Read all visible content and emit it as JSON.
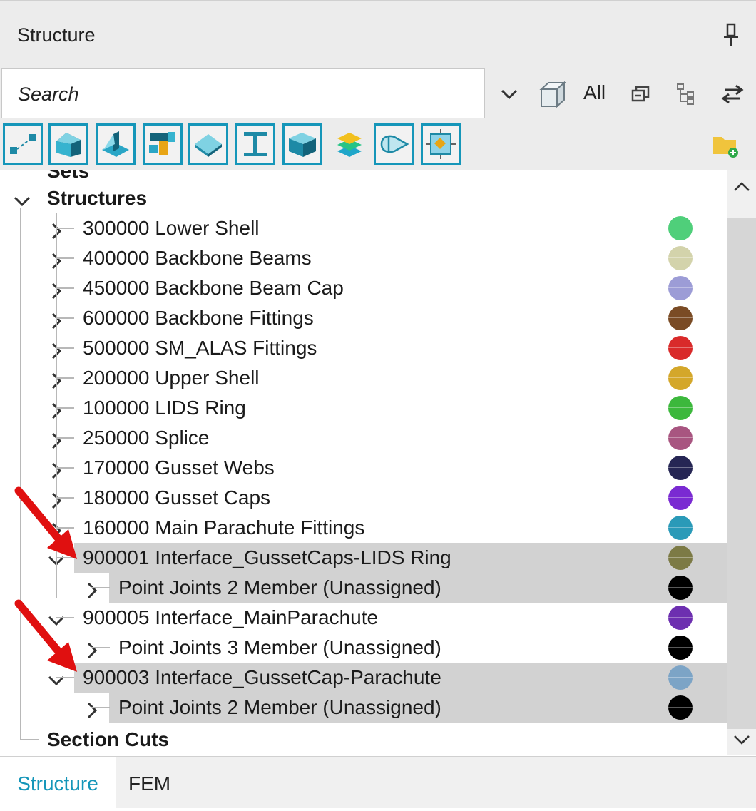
{
  "panel": {
    "title": "Structure"
  },
  "search": {
    "placeholder": "Search"
  },
  "toolbar": {
    "all_label": "All"
  },
  "tree": {
    "partial_header": "Sets",
    "structures_label": "Structures",
    "section_cuts_label": "Section Cuts",
    "items": [
      {
        "label": "300000 Lower Shell",
        "color": "#4fcf7a",
        "level": 1
      },
      {
        "label": "400000 Backbone Beams",
        "color": "#d3d3ab",
        "level": 1
      },
      {
        "label": "450000 Backbone Beam Cap",
        "color": "#9c9cd6",
        "level": 1
      },
      {
        "label": "600000 Backbone Fittings",
        "color": "#7a4b25",
        "level": 1
      },
      {
        "label": "500000 SM_ALAS Fittings",
        "color": "#d92a2a",
        "level": 1
      },
      {
        "label": "200000 Upper Shell",
        "color": "#d4a72a",
        "level": 1
      },
      {
        "label": "100000 LIDS Ring",
        "color": "#3cb83c",
        "level": 1
      },
      {
        "label": "250000 Splice",
        "color": "#a85580",
        "level": 1
      },
      {
        "label": "170000 Gusset Webs",
        "color": "#262654",
        "level": 1
      },
      {
        "label": "180000 Gusset Caps",
        "color": "#7a2ad2",
        "level": 1
      },
      {
        "label": "160000 Main Parachute Fittings",
        "color": "#2a9ab8",
        "level": 1
      },
      {
        "label": "900001 Interface_GussetCaps-LIDS Ring",
        "color": "#7c7a45",
        "level": 1,
        "expanded": true,
        "selected": true
      },
      {
        "label": "Point Joints 2 Member (Unassigned)",
        "color": "#000000",
        "level": 2,
        "selected": true
      },
      {
        "label": "900005 Interface_MainParachute",
        "color": "#6d2fb0",
        "level": 1,
        "expanded": true
      },
      {
        "label": "Point Joints 3 Member (Unassigned)",
        "color": "#000000",
        "level": 2
      },
      {
        "label": "900003 Interface_GussetCap-Parachute",
        "color": "#7ca4c6",
        "level": 1,
        "expanded": true,
        "selected": true
      },
      {
        "label": "Point Joints 2 Member (Unassigned)",
        "color": "#000000",
        "level": 2,
        "selected": true
      }
    ]
  },
  "tabs": {
    "structure_label": "Structure",
    "fem_label": "FEM"
  },
  "colors": {
    "accent": "#1596b9",
    "selection": "#d2d2d2",
    "annotation_arrow": "#e01010"
  },
  "icons": [
    "pin-icon",
    "chevron-down-icon",
    "cube-icon",
    "collapse-all-icon",
    "hierarchy-icon",
    "swap-icon",
    "point-joint-icon",
    "solid-icon",
    "plate-icon",
    "fitting-icon",
    "surface-icon",
    "beam-icon",
    "box-icon",
    "layers-icon",
    "parachute-icon",
    "section-icon",
    "new-folder-icon"
  ]
}
